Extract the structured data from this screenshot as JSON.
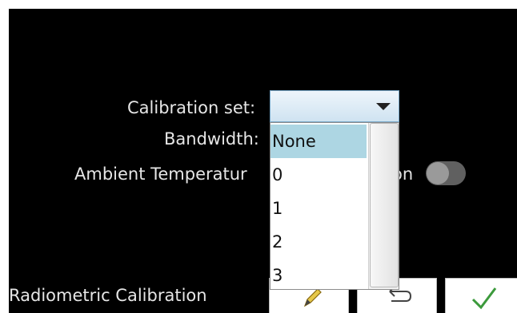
{
  "form": {
    "calibration_set_label": "Calibration set:",
    "bandwidth_label": "Bandwidth:",
    "ambient_label": "Ambient Temperatur",
    "ambient_label_tail": "on",
    "ambient_toggle_state": "off"
  },
  "dropdown": {
    "selected_value": "",
    "options": [
      "None",
      "0",
      "1",
      "2",
      "3"
    ],
    "highlighted_index": 0
  },
  "footer": {
    "title": "Radiometric Calibration"
  },
  "icons": {
    "edit": "pencil-icon",
    "back": "undo-arrow-icon",
    "ok": "checkmark-icon"
  },
  "colors": {
    "background": "#000000",
    "label_text": "#e6e6e6",
    "highlight": "#add6e3",
    "check": "#3c9a3c",
    "pencil": "#e6c84a"
  }
}
